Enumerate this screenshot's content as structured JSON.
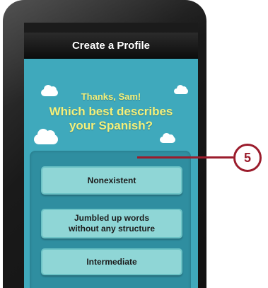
{
  "nav": {
    "title": "Create a Profile"
  },
  "prompt": {
    "greeting": "Thanks, Sam!",
    "question_line1": "Which best describes",
    "question_line2": "your Spanish?"
  },
  "options": [
    {
      "label": "Nonexistent"
    },
    {
      "label_line1": "Jumbled up words",
      "label_line2": "without any structure"
    },
    {
      "label": "Intermediate"
    }
  ],
  "callout": {
    "number": "5",
    "color": "#9b1c2c"
  },
  "colors": {
    "background": "#3fa9bc",
    "text_yellow": "#f4f07a",
    "option_fill": "#8fd6d6",
    "panel": "#2f8ea0"
  },
  "icons": [
    "cloud-icon"
  ]
}
